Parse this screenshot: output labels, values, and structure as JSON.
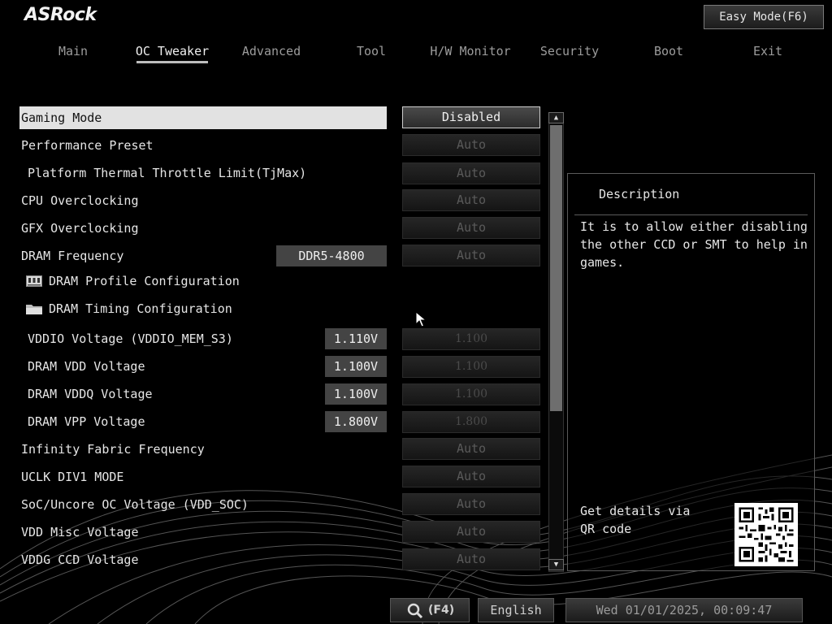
{
  "header": {
    "logo": "ASRock",
    "easy_mode": "Easy Mode(F6)"
  },
  "tabs": [
    {
      "label": "Main",
      "active": false
    },
    {
      "label": "OC Tweaker",
      "active": true
    },
    {
      "label": "Advanced",
      "active": false
    },
    {
      "label": "Tool",
      "active": false
    },
    {
      "label": "H/W Monitor",
      "active": false
    },
    {
      "label": "Security",
      "active": false
    },
    {
      "label": "Boot",
      "active": false
    },
    {
      "label": "Exit",
      "active": false
    }
  ],
  "settings": [
    {
      "label": "Gaming Mode",
      "option": "Disabled"
    },
    {
      "label": "Performance Preset",
      "option": "Auto"
    },
    {
      "label": "Platform Thermal Throttle Limit(TjMax)",
      "option": "Auto"
    },
    {
      "label": "CPU Overclocking",
      "option": "Auto"
    },
    {
      "label": "GFX Overclocking",
      "option": "Auto"
    },
    {
      "label": "DRAM Frequency",
      "value": "DDR5-4800",
      "option": "Auto"
    },
    {
      "label": "DRAM Profile Configuration"
    },
    {
      "label": "DRAM Timing Configuration"
    },
    {
      "label": "VDDIO Voltage (VDDIO_MEM_S3)",
      "value": "1.110V",
      "option": "1.100"
    },
    {
      "label": "DRAM VDD Voltage",
      "value": "1.100V",
      "option": "1.100"
    },
    {
      "label": "DRAM VDDQ Voltage",
      "value": "1.100V",
      "option": "1.100"
    },
    {
      "label": "DRAM VPP Voltage",
      "value": "1.800V",
      "option": "1.800"
    },
    {
      "label": "Infinity Fabric Frequency",
      "option": "Auto"
    },
    {
      "label": "UCLK DIV1 MODE",
      "option": "Auto"
    },
    {
      "label": "SoC/Uncore OC Voltage (VDD_SOC)",
      "option": "Auto"
    },
    {
      "label": "VDD Misc Voltage",
      "option": "Auto"
    },
    {
      "label": "VDDG CCD Voltage",
      "option": "Auto"
    }
  ],
  "description": {
    "title": "Description",
    "text": "It is to allow either disabling the other CCD or SMT to help in games.",
    "qr_text": "Get details via QR code"
  },
  "footer": {
    "search_key": "(F4)",
    "language": "English",
    "datetime": "Wed 01/01/2025, 00:09:47"
  },
  "icons": {
    "search": "search-icon",
    "profile": "memory-module-icon",
    "timing": "folder-icon"
  }
}
